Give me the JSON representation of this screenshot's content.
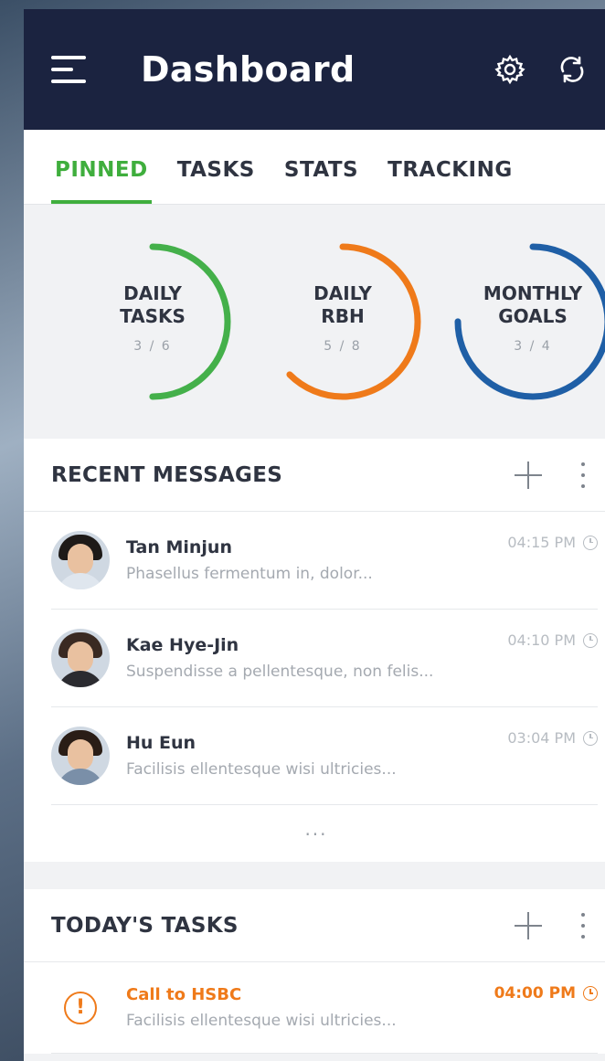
{
  "header": {
    "title": "Dashboard",
    "menu_icon": "hamburger-menu-icon",
    "settings_icon": "gear-icon",
    "sync_icon": "sync-icon",
    "background": "#1b2340"
  },
  "tabs": [
    {
      "label": "PINNED",
      "active": true
    },
    {
      "label": "TASKS",
      "active": false
    },
    {
      "label": "STATS",
      "active": false
    },
    {
      "label": "TRACKING",
      "active": false
    }
  ],
  "progress_rings": [
    {
      "label": "DAILY\nTASKS",
      "value": "3 / 6",
      "progress": 0.5,
      "color": "#44b04a"
    },
    {
      "label": "DAILY\nRBH",
      "value": "5 / 8",
      "progress": 0.625,
      "color": "#ef7a1a"
    },
    {
      "label": "MONTHLY\nGOALS",
      "value": "3 / 4",
      "progress": 0.75,
      "color": "#1f5fa6"
    }
  ],
  "recent_messages": {
    "title": "RECENT MESSAGES",
    "add_icon": "plus-icon",
    "more_icon": "more-vertical-icon",
    "items": [
      {
        "name": "Tan Minjun",
        "preview": "Phasellus fermentum in, dolor...",
        "time": "04:15 PM"
      },
      {
        "name": "Kae Hye-Jin",
        "preview": "Suspendisse a pellentesque, non felis...",
        "time": "04:10 PM"
      },
      {
        "name": "Hu Eun",
        "preview": "Facilisis ellentesque wisi ultricies...",
        "time": "03:04 PM"
      }
    ],
    "more_label": "..."
  },
  "todays_tasks": {
    "title": "TODAY'S TASKS",
    "add_icon": "plus-icon",
    "more_icon": "more-vertical-icon",
    "items": [
      {
        "title": "Call to HSBC",
        "subtitle": "Facilisis ellentesque wisi ultricies...",
        "time": "04:00 PM",
        "icon": "alert-icon",
        "color": "#ef7a1a"
      }
    ]
  },
  "accent_color": "#3fae3d"
}
